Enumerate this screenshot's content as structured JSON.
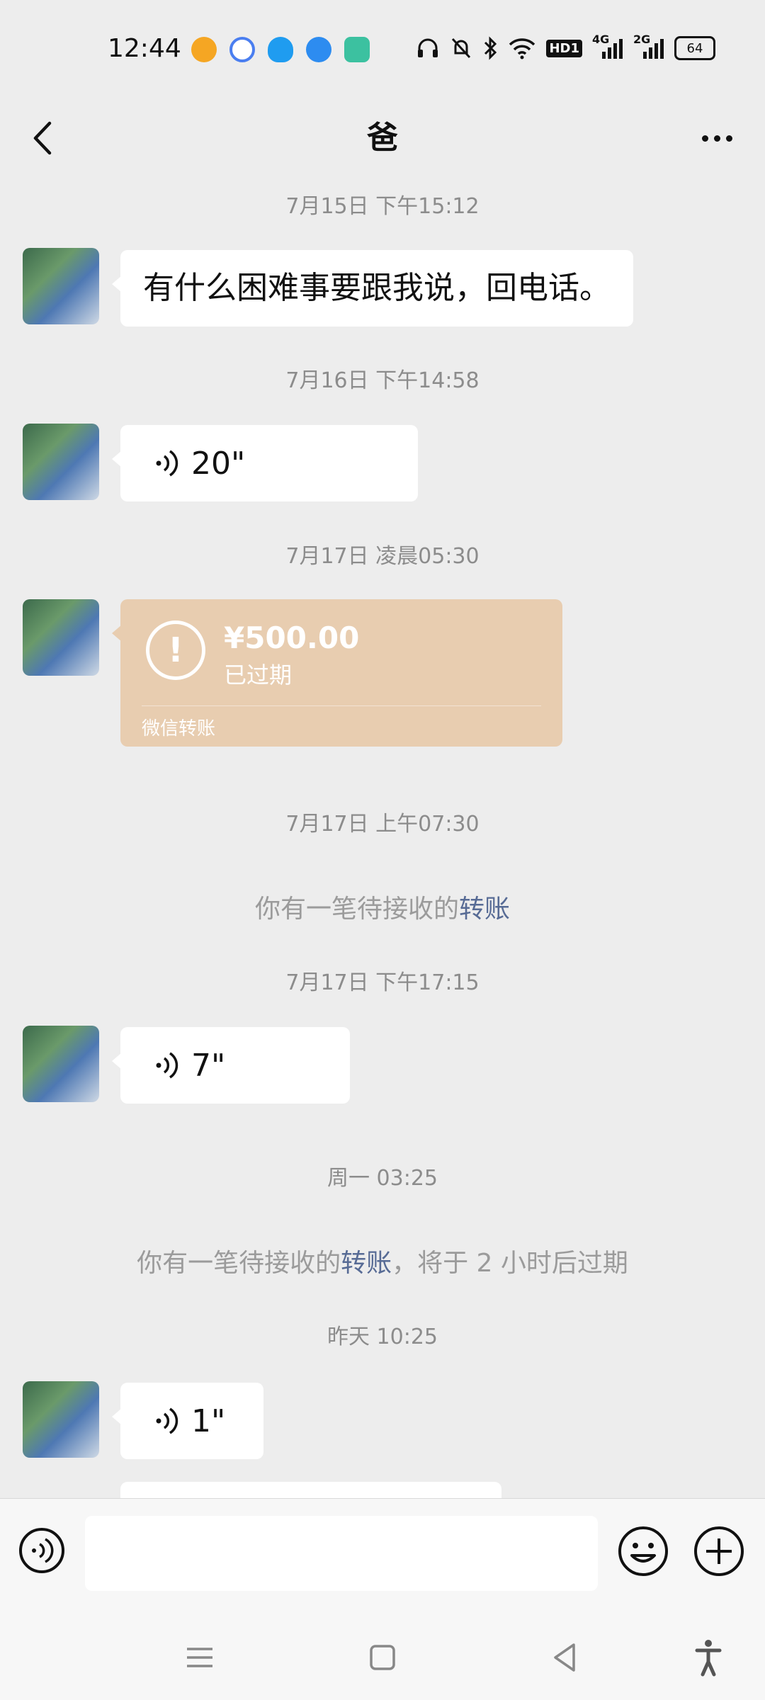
{
  "status_bar": {
    "time": "12:44",
    "apps": [
      {
        "icon": "weibo-icon",
        "color": "#f5a623"
      },
      {
        "icon": "baidu-netdisk-icon",
        "color": "#4a7ef0"
      },
      {
        "icon": "qq-icon",
        "color": "#1f9cf0"
      },
      {
        "icon": "browser-icon",
        "color": "#2d8cf0"
      },
      {
        "icon": "shield-app-icon",
        "color": "#3cc1a0"
      }
    ],
    "network_4g": "4G",
    "network_2g": "2G",
    "hd_label": "HD1",
    "battery": "64"
  },
  "header": {
    "title": "爸"
  },
  "messages": {
    "ts1": "7月15日 下午15:12",
    "text1": "有什么困难事要跟我说，回电话。",
    "ts2": "7月16日 下午14:58",
    "voice1": "20\"",
    "ts3": "7月17日 凌晨05:30",
    "transfer": {
      "amount": "¥500.00",
      "status": "已过期",
      "label": "微信转账",
      "color": "#e8cdb0"
    },
    "ts4": "7月17日 上午07:30",
    "sys1_prefix": "你有一笔待接收的",
    "sys1_link": "转账",
    "ts5": "7月17日 下午17:15",
    "voice2": "7\"",
    "ts6": "周一 03:25",
    "sys2_prefix": "你有一笔待接收的",
    "sys2_link": "转账",
    "sys2_suffix": "，将于 2 小时后过期",
    "ts7": "昨天 10:25",
    "voice3": "1\""
  },
  "colors": {
    "link": "#576b95",
    "background": "#ededed"
  }
}
